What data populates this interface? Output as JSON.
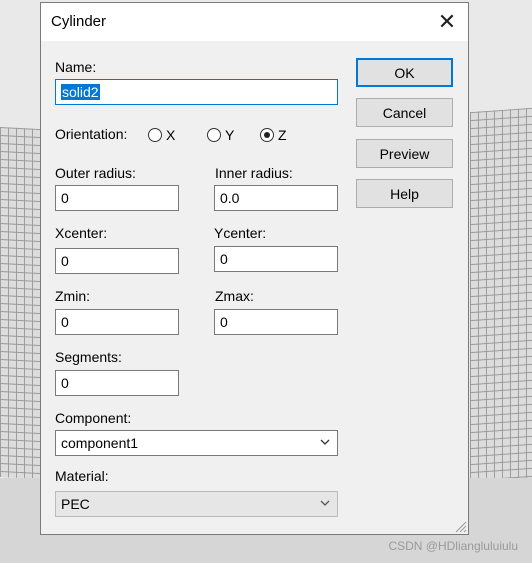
{
  "dialog": {
    "title": "Cylinder"
  },
  "fields": {
    "name": {
      "label": "Name:",
      "value": "solid2"
    },
    "orientation": {
      "label": "Orientation:",
      "options": [
        "X",
        "Y",
        "Z"
      ],
      "selected": "Z"
    },
    "outer_radius": {
      "label": "Outer radius:",
      "value": "0"
    },
    "inner_radius": {
      "label": "Inner radius:",
      "value": "0.0"
    },
    "xcenter": {
      "label": "Xcenter:",
      "value": "0"
    },
    "ycenter": {
      "label": "Ycenter:",
      "value": "0"
    },
    "zmin": {
      "label": "Zmin:",
      "value": "0"
    },
    "zmax": {
      "label": "Zmax:",
      "value": "0"
    },
    "segments": {
      "label": "Segments:",
      "value": "0"
    },
    "component": {
      "label": "Component:",
      "value": "component1"
    },
    "material": {
      "label": "Material:",
      "value": "PEC"
    }
  },
  "buttons": {
    "ok": "OK",
    "cancel": "Cancel",
    "preview": "Preview",
    "help": "Help"
  },
  "watermark": "CSDN @HDliangluluiulu",
  "icons": {
    "close": "close-icon",
    "chevron": "chevron-down-icon",
    "grip": "resize-grip-icon"
  },
  "colors": {
    "accent": "#0078d7",
    "dialog_bg": "#f0f0f0",
    "titlebar_bg": "#ffffff"
  }
}
